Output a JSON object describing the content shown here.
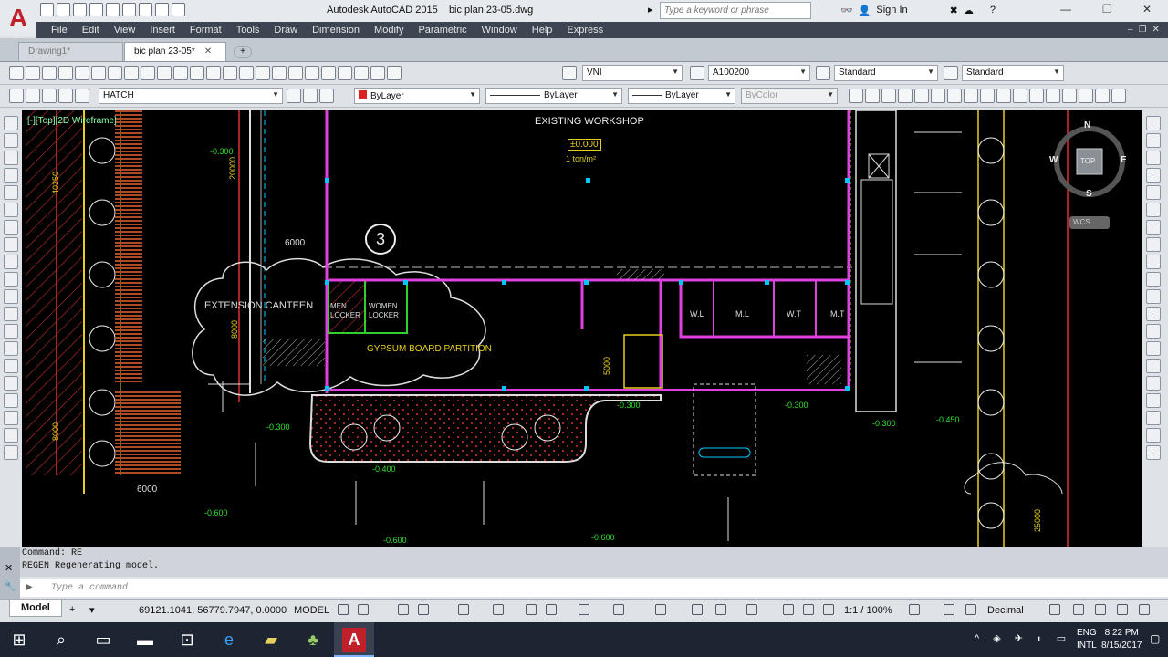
{
  "app": {
    "title": "Autodesk AutoCAD 2015",
    "filename": "bic plan 23-05.dwg",
    "search_placeholder": "Type a keyword or phrase",
    "signin": "Sign In"
  },
  "menu": [
    "File",
    "Edit",
    "View",
    "Insert",
    "Format",
    "Tools",
    "Draw",
    "Dimension",
    "Modify",
    "Parametric",
    "Window",
    "Help",
    "Express"
  ],
  "tabs": [
    {
      "label": "Drawing1*"
    },
    {
      "label": "bic plan 23-05*"
    }
  ],
  "toolbar1": {
    "text_style": "VNI",
    "dim_style": "A100200",
    "table_style": "Standard",
    "mleader_style": "Standard"
  },
  "toolbar2": {
    "layer": "HATCH",
    "color": "ByLayer",
    "linetype": "ByLayer",
    "lineweight": "ByLayer",
    "plotstyle": "ByColor"
  },
  "viewport_label": "[-][Top][2D Wireframe]",
  "viewcube": {
    "n": "N",
    "s": "S",
    "e": "E",
    "w": "W",
    "face": "TOP",
    "wcs": "WCS"
  },
  "drawing": {
    "labels": {
      "existing_workshop": "EXISTING WORKSHOP",
      "level_0": "±0.000",
      "load": "1 ton/m²",
      "callout": "3",
      "extension_canteen": "EXTENSION CANTEEN",
      "men_locker": "MEN\nLOCKER",
      "women_locker": "WOMEN\nLOCKER",
      "gypsum": "GYPSUM BOARD PARTITION",
      "wl": "W.L",
      "ml": "M.L",
      "wt": "W.T",
      "mt": "M.T"
    },
    "dims": {
      "d6000a": "6000",
      "d6000b": "6000",
      "d20000": "20000",
      "d40250": "40250",
      "d8000a": "8000",
      "d8000b": "8000",
      "d5000": "5000",
      "d25000": "25000"
    },
    "levels": {
      "l1": "-0.300",
      "l2": "-0.300",
      "l3": "-0.300",
      "l4": "-0.300",
      "l5": "-0.300",
      "l6": "-0.450",
      "l7": "-0.400",
      "l8": "-0.600",
      "l9": "-0.600",
      "l10": "-0.600"
    }
  },
  "command": {
    "line1": "Command: RE",
    "line2": "REGEN Regenerating model.",
    "placeholder": "Type a command"
  },
  "status": {
    "model_tab": "Model",
    "coords": "69121.1041, 56779.7947, 0.0000",
    "model": "MODEL",
    "scale": "1:1 / 100%",
    "units": "Decimal"
  },
  "taskbar": {
    "lang": "ENG",
    "lang2": "INTL",
    "time": "8:22 PM",
    "date": "8/15/2017"
  }
}
